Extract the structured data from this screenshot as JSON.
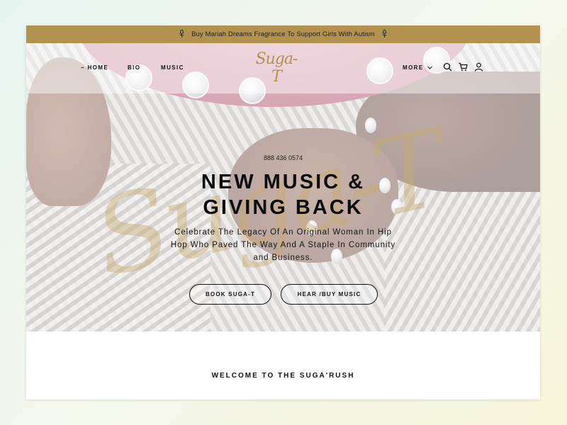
{
  "announcement": {
    "text": "Buy Mariah Dreams Fragrance To Support Girls With Autism",
    "left_icon": "rose-icon",
    "right_icon": "rose-icon"
  },
  "nav": {
    "home": "HOME",
    "bio": "BIO",
    "music": "MUSIC",
    "more": "MORE",
    "logo": "Suga-T",
    "icons": [
      "search-icon",
      "cart-icon",
      "account-icon",
      "chevron-down-icon"
    ]
  },
  "hero": {
    "watermark": "Suga-T",
    "phone": "888 436 0574",
    "headline_line1": "NEW MUSIC &",
    "headline_line2": "GIVING BACK",
    "subtitle": "Celebrate The Legacy Of An Original Woman In Hip Hop Who Paved The Way And A Staple In Community and Business.",
    "buttons": {
      "book": "BOOK SUGA-T",
      "hear": "HEAR /BUY MUSIC"
    }
  },
  "section": {
    "welcome": "WELCOME TO THE SUGA'RUSH"
  },
  "colors": {
    "accent_gold": "#b3914f",
    "text_dark": "#111111",
    "background": "#ffffff"
  }
}
